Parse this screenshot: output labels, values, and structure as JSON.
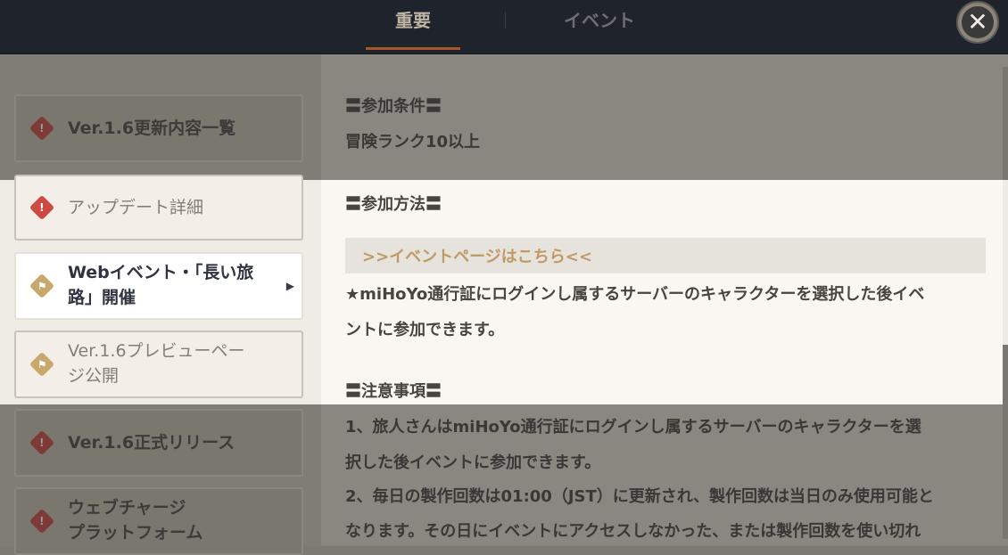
{
  "tabs": [
    {
      "label": "重要",
      "active": true
    },
    {
      "label": "イベント",
      "active": false
    }
  ],
  "close_button": {
    "label": "✕"
  },
  "sidebar": {
    "items": [
      {
        "label_line1": "Ver.1.6更新内容一覧",
        "label_line2": "",
        "icon": "red-diamond-alert-icon"
      },
      {
        "label_line1": "アップデート詳細",
        "label_line2": "",
        "icon": "red-diamond-alert-icon"
      },
      {
        "label_line1": "Webイベント・「長い旅",
        "label_line2": "路」開催",
        "icon": "tan-diamond-flag-icon"
      },
      {
        "label_line1": "Ver.1.6プレビューペー",
        "label_line2": "ジ公開",
        "icon": "tan-diamond-flag-icon"
      },
      {
        "label_line1": "Ver.1.6正式リリース",
        "label_line2": "",
        "icon": "red-diamond-alert-icon"
      },
      {
        "label_line1": "ウェブチャージ",
        "label_line2": "プラットフォーム",
        "icon": "red-diamond-alert-icon"
      }
    ]
  },
  "content": {
    "section1_heading": "〓参加条件〓",
    "section1_text": "冒険ランク10以上",
    "section2_heading": "〓参加方法〓",
    "link_text": ">>イベントページはこちら<<",
    "section2_line1": "★miHoYo通行証にログインし属するサーバーのキャラクターを選択した後イベ",
    "section2_line2": "ントに参加できます。",
    "section3_heading": "〓注意事項〓",
    "note1_line1": "1、旅人さんはmiHoYo通行証にログインし属するサーバーのキャラクターを選",
    "note1_line2": "択した後イベントに参加できます。",
    "note2_line1": "2、毎日の製作回数は01:00（JST）に更新され、製作回数は当日のみ使用可能と",
    "note2_line2": "なります。その日にイベントにアクセスしなかった、または製作回数を使い切れ"
  },
  "colors": {
    "topbar": "#1f232b",
    "accent_underline": "#a8552c",
    "link": "#c09a65",
    "alert_red": "#cc4a43",
    "event_tan": "#c9a86e"
  }
}
